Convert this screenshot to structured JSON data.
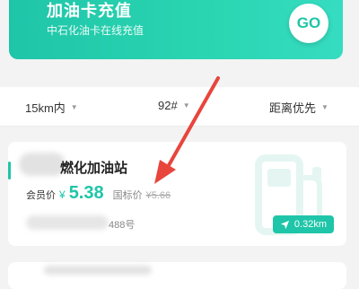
{
  "banner": {
    "title": "加油卡充值",
    "subtitle": "中石化油卡在线充值",
    "go_label": "GO"
  },
  "filters": [
    {
      "label": "15km内",
      "icon": "caret-down-icon"
    },
    {
      "label": "92#",
      "icon": "caret-down-icon"
    },
    {
      "label": "距离优先",
      "icon": "caret-down-icon"
    }
  ],
  "station": {
    "name": "燃化加油站",
    "member_label": "会员价",
    "currency": "¥",
    "member_price": "5.38",
    "standard_label": "国标价",
    "standard_price": "¥5.66",
    "address": "488号",
    "distance": "0.32km"
  },
  "colors": {
    "accent": "#1fc5a8",
    "arrow": "#e8453c"
  }
}
